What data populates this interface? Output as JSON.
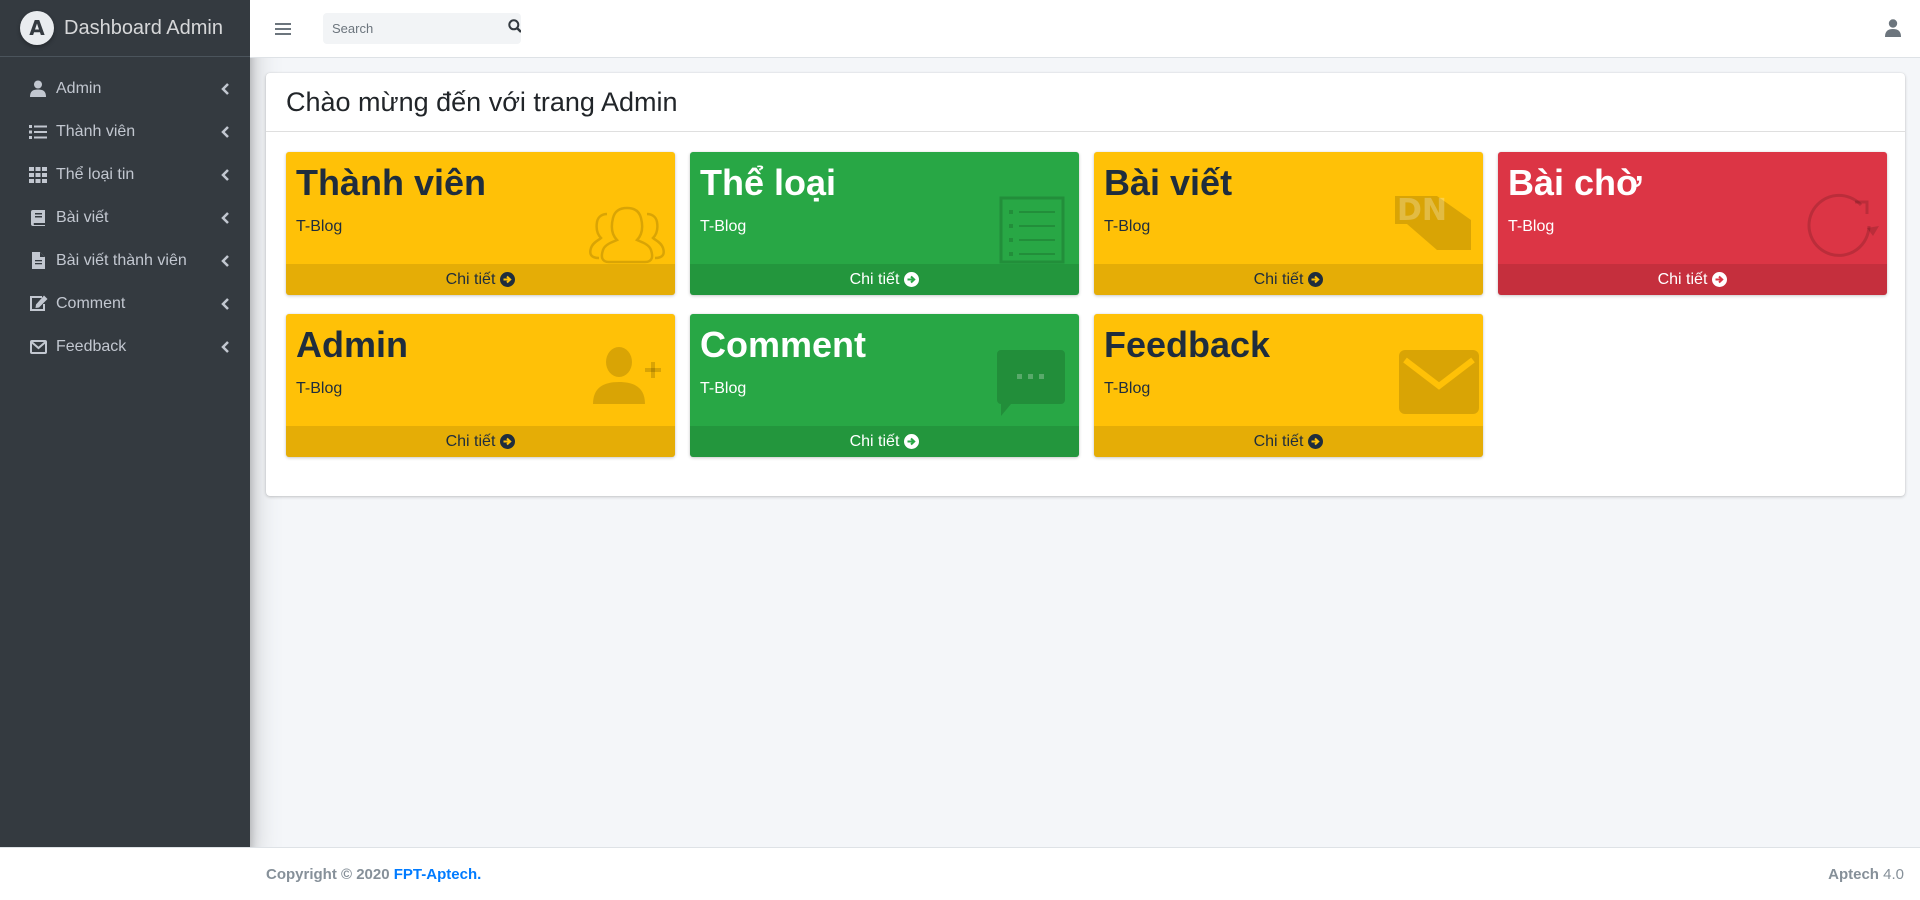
{
  "sidebar": {
    "brand_logo_letter": "A",
    "brand_title": "Dashboard Admin",
    "items": [
      {
        "label": "Admin",
        "icon": "user-icon"
      },
      {
        "label": "Thành viên",
        "icon": "list-icon"
      },
      {
        "label": "Thể loại tin",
        "icon": "grid-icon"
      },
      {
        "label": "Bài viết",
        "icon": "book-icon"
      },
      {
        "label": "Bài viết thành viên",
        "icon": "file-icon"
      },
      {
        "label": "Comment",
        "icon": "edit-icon"
      },
      {
        "label": "Feedback",
        "icon": "envelope-icon"
      }
    ]
  },
  "header": {
    "search_placeholder": "Search"
  },
  "main": {
    "title": "Chào mừng đến với trang Admin",
    "boxes": [
      {
        "title": "Thành viên",
        "subtitle": "T-Blog",
        "link": "Chi tiết",
        "color": "#ffc107",
        "icon": "users-icon"
      },
      {
        "title": "Thể loại",
        "subtitle": "T-Blog",
        "link": "Chi tiết",
        "color": "#28a745",
        "icon": "list-alt-icon"
      },
      {
        "title": "Bài viết",
        "subtitle": "T-Blog",
        "link": "Chi tiết",
        "color": "#ffc107",
        "icon": "dn-logo-icon"
      },
      {
        "title": "Bài chờ",
        "subtitle": "T-Blog",
        "link": "Chi tiết",
        "color": "#dc3545",
        "icon": "redo-icon"
      },
      {
        "title": "Admin",
        "subtitle": "T-Blog",
        "link": "Chi tiết",
        "color": "#ffc107",
        "icon": "user-plus-icon"
      },
      {
        "title": "Comment",
        "subtitle": "T-Blog",
        "link": "Chi tiết",
        "color": "#28a745",
        "icon": "comment-icon"
      },
      {
        "title": "Feedback",
        "subtitle": "T-Blog",
        "link": "Chi tiết",
        "color": "#ffc107",
        "icon": "envelope-icon"
      }
    ]
  },
  "footer": {
    "copyright": "Copyright © 2020",
    "brand": "FPT-Aptech.",
    "app_name": "Aptech",
    "version": "4.0"
  }
}
